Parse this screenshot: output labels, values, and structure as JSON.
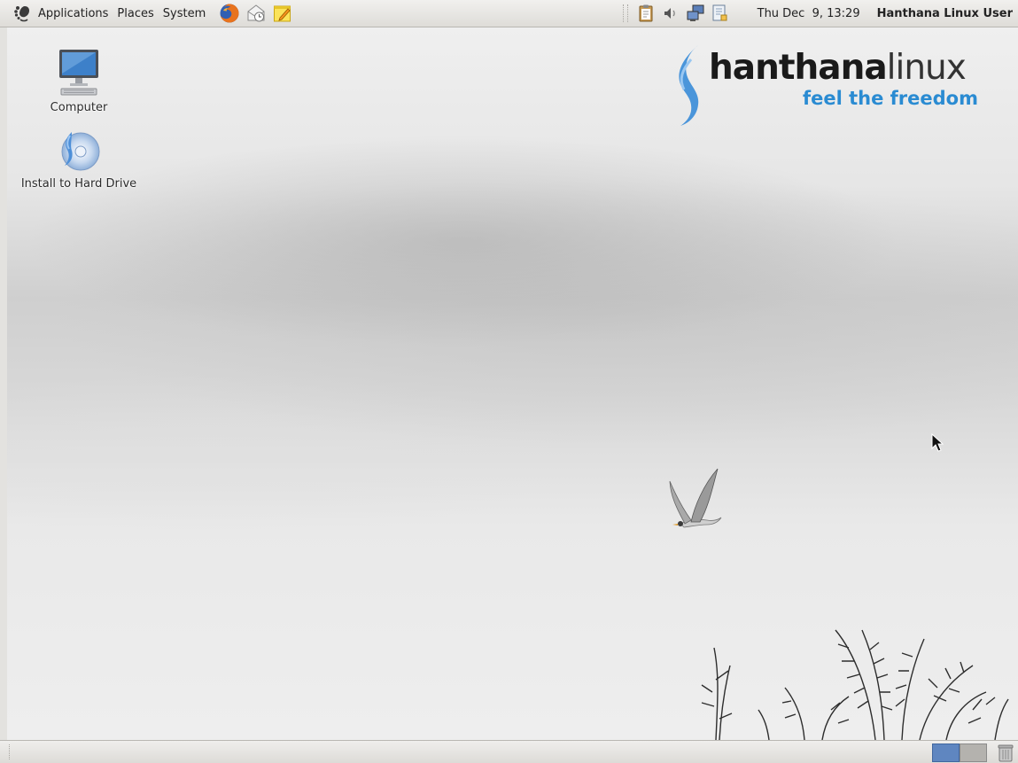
{
  "top_panel": {
    "menus": [
      "Applications",
      "Places",
      "System"
    ],
    "launchers": [
      "firefox-icon",
      "mail-clock-icon",
      "notes-icon"
    ],
    "tray_icons": [
      "clipboard-icon",
      "volume-icon",
      "network-icon",
      "update-icon"
    ],
    "clock": "Thu Dec  9, 13:29",
    "user": "Hanthana Linux User"
  },
  "desktop": {
    "icons": [
      {
        "label": "Computer",
        "icon": "computer-icon"
      },
      {
        "label": "Install to Hard Drive",
        "icon": "install-disc-icon"
      }
    ],
    "brand": {
      "name_bold": "hanthana",
      "name_light": "linux",
      "tagline": "feel the freedom"
    }
  },
  "bottom_panel": {
    "workspaces": 2,
    "active_workspace": 1,
    "trash_icon": "trash-icon"
  },
  "colors": {
    "brand_blue": "#2a8bd2",
    "active_workspace": "#5f86c0"
  }
}
